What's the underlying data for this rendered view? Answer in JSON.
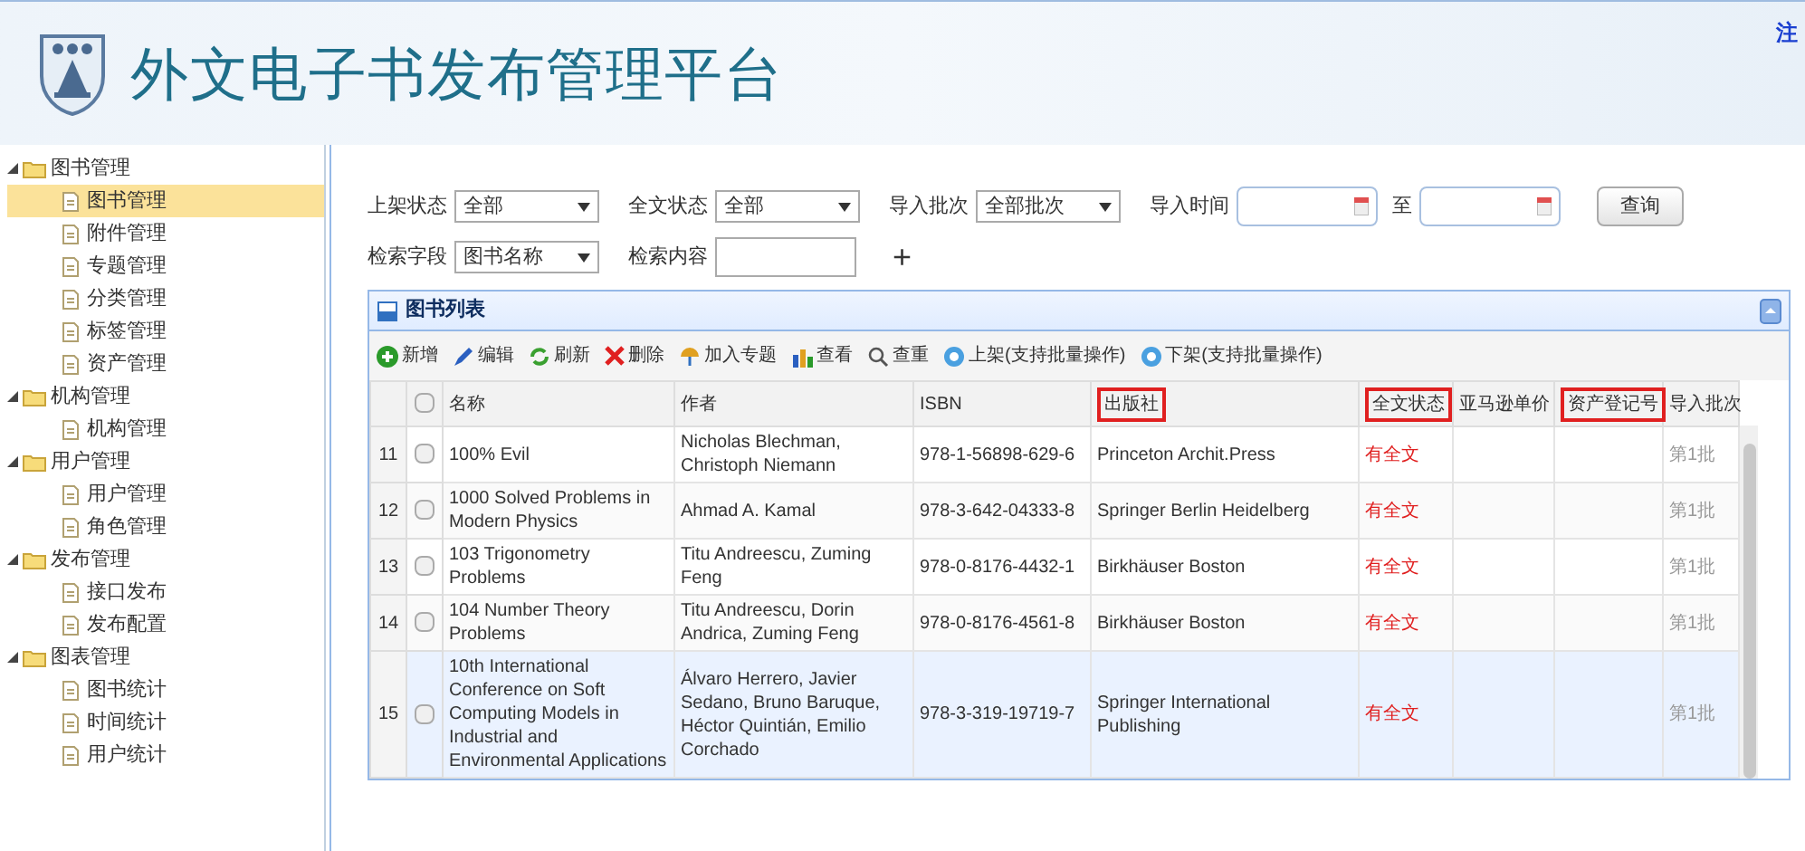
{
  "header": {
    "title": "外文电子书发布管理平台",
    "link": "注"
  },
  "sidebar": {
    "items": [
      {
        "label": "图书管理",
        "expanded": true,
        "children": [
          {
            "label": "图书管理",
            "selected": true
          },
          {
            "label": "附件管理",
            "selected": false
          },
          {
            "label": "专题管理",
            "selected": false
          },
          {
            "label": "分类管理",
            "selected": false
          },
          {
            "label": "标签管理",
            "selected": false
          },
          {
            "label": "资产管理",
            "selected": false
          }
        ]
      },
      {
        "label": "机构管理",
        "expanded": true,
        "children": [
          {
            "label": "机构管理",
            "selected": false
          }
        ]
      },
      {
        "label": "用户管理",
        "expanded": true,
        "children": [
          {
            "label": "用户管理",
            "selected": false
          },
          {
            "label": "角色管理",
            "selected": false
          }
        ]
      },
      {
        "label": "发布管理",
        "expanded": true,
        "children": [
          {
            "label": "接口发布",
            "selected": false
          },
          {
            "label": "发布配置",
            "selected": false
          }
        ]
      },
      {
        "label": "图表管理",
        "expanded": true,
        "children": [
          {
            "label": "图书统计",
            "selected": false
          },
          {
            "label": "时间统计",
            "selected": false
          },
          {
            "label": "用户统计",
            "selected": false
          }
        ]
      }
    ]
  },
  "filters": [
    [
      {
        "kind": "select",
        "label": "上架状态",
        "value": "全部"
      },
      {
        "kind": "select",
        "label": "全文状态",
        "value": "全部"
      },
      {
        "kind": "select",
        "label": "导入批次",
        "value": "全部批次"
      },
      {
        "kind": "date",
        "label": "导入时间"
      },
      {
        "kind": "date",
        "label": "至"
      },
      {
        "kind": "button",
        "label": "查询"
      }
    ],
    [
      {
        "kind": "select",
        "label": "检索字段",
        "value": "图书名称"
      },
      {
        "kind": "text",
        "label": "检索内容"
      },
      {
        "kind": "plus",
        "label": "+"
      }
    ]
  ],
  "panel": {
    "title": "图书列表",
    "toolbar": [
      {
        "kind": "add",
        "label": "新增"
      },
      {
        "kind": "edit",
        "label": "编辑"
      },
      {
        "kind": "refresh",
        "label": "刷新"
      },
      {
        "kind": "delete",
        "label": "删除"
      },
      {
        "kind": "topic",
        "label": "加入专题"
      },
      {
        "kind": "view",
        "label": "查看"
      },
      {
        "kind": "search",
        "label": "查重"
      },
      {
        "kind": "up",
        "label": "上架(支持批量操作)"
      },
      {
        "kind": "down",
        "label": "下架(支持批量操作)"
      }
    ],
    "table": {
      "all_checked": false,
      "columns": [
        {
          "label": "名称",
          "highlighted": false
        },
        {
          "label": "作者",
          "highlighted": false
        },
        {
          "label": "ISBN",
          "highlighted": false
        },
        {
          "label": "出版社",
          "highlighted": true
        },
        {
          "label": "全文状态",
          "highlighted": true
        },
        {
          "label": "亚马逊单价",
          "highlighted": false
        },
        {
          "label": "资产登记号",
          "highlighted": true
        },
        {
          "label": "导入批次",
          "highlighted": false
        }
      ],
      "rows": [
        {
          "number": "11",
          "checked": false,
          "selected": false,
          "name": "100% Evil",
          "author": "Nicholas Blechman, Christoph Niemann",
          "isbn": "978-1-56898-629-6",
          "publisher": "Princeton Archit.Press",
          "fulltext": "有全文",
          "batch": "第1批"
        },
        {
          "number": "12",
          "checked": false,
          "selected": false,
          "name": "1000 Solved Problems in Modern Physics",
          "author": "Ahmad A. Kamal",
          "isbn": "978-3-642-04333-8",
          "publisher": "Springer Berlin Heidelberg",
          "fulltext": "有全文",
          "batch": "第1批"
        },
        {
          "number": "13",
          "checked": false,
          "selected": false,
          "name": "103 Trigonometry Problems",
          "author": "Titu Andreescu, Zuming Feng",
          "isbn": "978-0-8176-4432-1",
          "publisher": "Birkhäuser Boston",
          "fulltext": "有全文",
          "batch": "第1批"
        },
        {
          "number": "14",
          "checked": false,
          "selected": false,
          "name": "104 Number Theory Problems",
          "author": "Titu Andreescu, Dorin Andrica, Zuming Feng",
          "isbn": "978-0-8176-4561-8",
          "publisher": "Birkhäuser Boston",
          "fulltext": "有全文",
          "batch": "第1批"
        },
        {
          "number": "15",
          "checked": false,
          "selected": true,
          "name": "10th International Conference on Soft Computing Models in Industrial and Environmental Applications",
          "author": "Álvaro Herrero, Javier Sedano, Bruno Baruque, Héctor Quintián, Emilio Corchado",
          "isbn": "978-3-319-19719-7",
          "publisher": "Springer International Publishing",
          "fulltext": "有全文",
          "batch": "第1批"
        }
      ]
    }
  }
}
